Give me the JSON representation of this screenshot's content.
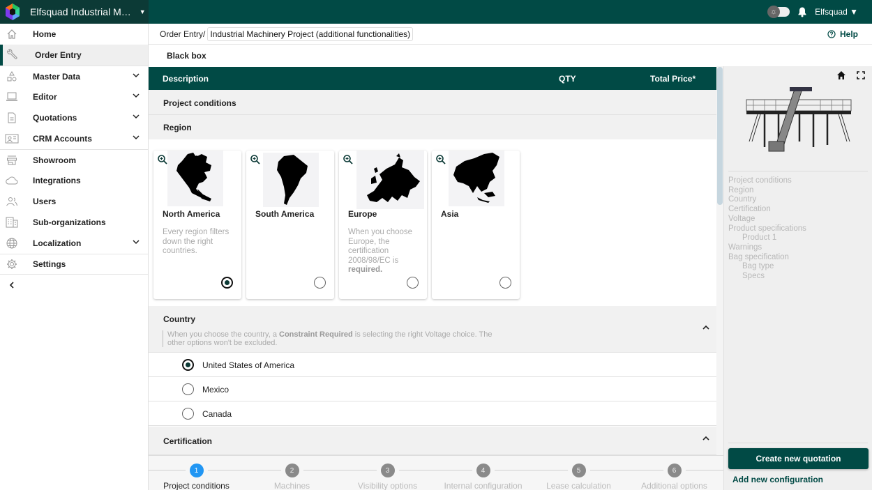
{
  "app": {
    "title": "Elfsquad Industrial M…",
    "user": "Elfsquad"
  },
  "sidebar": {
    "items": [
      {
        "label": "Home",
        "icon": "home-icon",
        "expandable": false
      },
      {
        "label": "Order Entry",
        "icon": "wrench-icon",
        "expandable": false,
        "active": true
      },
      {
        "label": "Master Data",
        "icon": "shapes-icon",
        "expandable": true
      },
      {
        "label": "Editor",
        "icon": "laptop-icon",
        "expandable": true
      },
      {
        "label": "Quotations",
        "icon": "document-icon",
        "expandable": true
      },
      {
        "label": "CRM Accounts",
        "icon": "contact-card-icon",
        "expandable": true
      },
      {
        "label": "Showroom",
        "icon": "storefront-icon",
        "expandable": false
      },
      {
        "label": "Integrations",
        "icon": "cloud-icon",
        "expandable": false
      },
      {
        "label": "Users",
        "icon": "users-icon",
        "expandable": false
      },
      {
        "label": "Sub-organizations",
        "icon": "building-icon",
        "expandable": false
      },
      {
        "label": "Localization",
        "icon": "globe-icon",
        "expandable": true
      },
      {
        "label": "Settings",
        "icon": "gear-icon",
        "expandable": false
      }
    ],
    "collapse_icon": "chevron-left-icon"
  },
  "header": {
    "breadcrumb_root": "Order Entry/",
    "project_name": "Industrial Machinery Project (additional functionalities)",
    "help_label": "Help",
    "subtab_label": "Black box"
  },
  "table": {
    "columns": {
      "description": "Description",
      "qty": "QTY",
      "total_price": "Total Price*"
    }
  },
  "config": {
    "project_conditions_label": "Project conditions",
    "region": {
      "label": "Region",
      "cards": [
        {
          "name": "North America",
          "description": "Every region filters down the right countries.",
          "selected": true
        },
        {
          "name": "South America",
          "description": "",
          "selected": false
        },
        {
          "name": "Europe",
          "description_prefix": "When you choose Europe, the certification 2008/98/EC is ",
          "description_bold": "required.",
          "selected": false
        },
        {
          "name": "Asia",
          "description": "",
          "selected": false
        }
      ]
    },
    "country": {
      "label": "Country",
      "hint_prefix": "When you choose the country, a ",
      "hint_bold": "Constraint Required",
      "hint_suffix": " is selecting the right Voltage choice. The other options won't be excluded.",
      "options": [
        {
          "label": "United States of America",
          "selected": true
        },
        {
          "label": "Mexico",
          "selected": false
        },
        {
          "label": "Canada",
          "selected": false
        }
      ]
    },
    "certification": {
      "label": "Certification"
    }
  },
  "stepper": {
    "current_step": 1,
    "steps": [
      {
        "number": "1",
        "label": "Project conditions"
      },
      {
        "number": "2",
        "label": "Machines"
      },
      {
        "number": "3",
        "label": "Visibility options"
      },
      {
        "number": "4",
        "label": "Internal configuration"
      },
      {
        "number": "5",
        "label": "Lease calculation"
      },
      {
        "number": "6",
        "label": "Additional options"
      }
    ]
  },
  "preview": {
    "toc": [
      {
        "label": "Project conditions",
        "level": 0
      },
      {
        "label": "Region",
        "level": 0
      },
      {
        "label": "Country",
        "level": 0
      },
      {
        "label": "Certification",
        "level": 0
      },
      {
        "label": "Voltage",
        "level": 0
      },
      {
        "label": "Product specifications",
        "level": 0
      },
      {
        "label": "Product 1",
        "level": 1
      },
      {
        "label": "Warnings",
        "level": 0
      },
      {
        "label": "Bag specification",
        "level": 0
      },
      {
        "label": "Bag type",
        "level": 1
      },
      {
        "label": "Specs",
        "level": 1
      }
    ],
    "create_button": "Create new quotation",
    "add_config_link": "Add new configuration"
  },
  "colors": {
    "brand": "#014a45",
    "brand_dark": "#0c3a36",
    "step_active": "#2196f3"
  }
}
